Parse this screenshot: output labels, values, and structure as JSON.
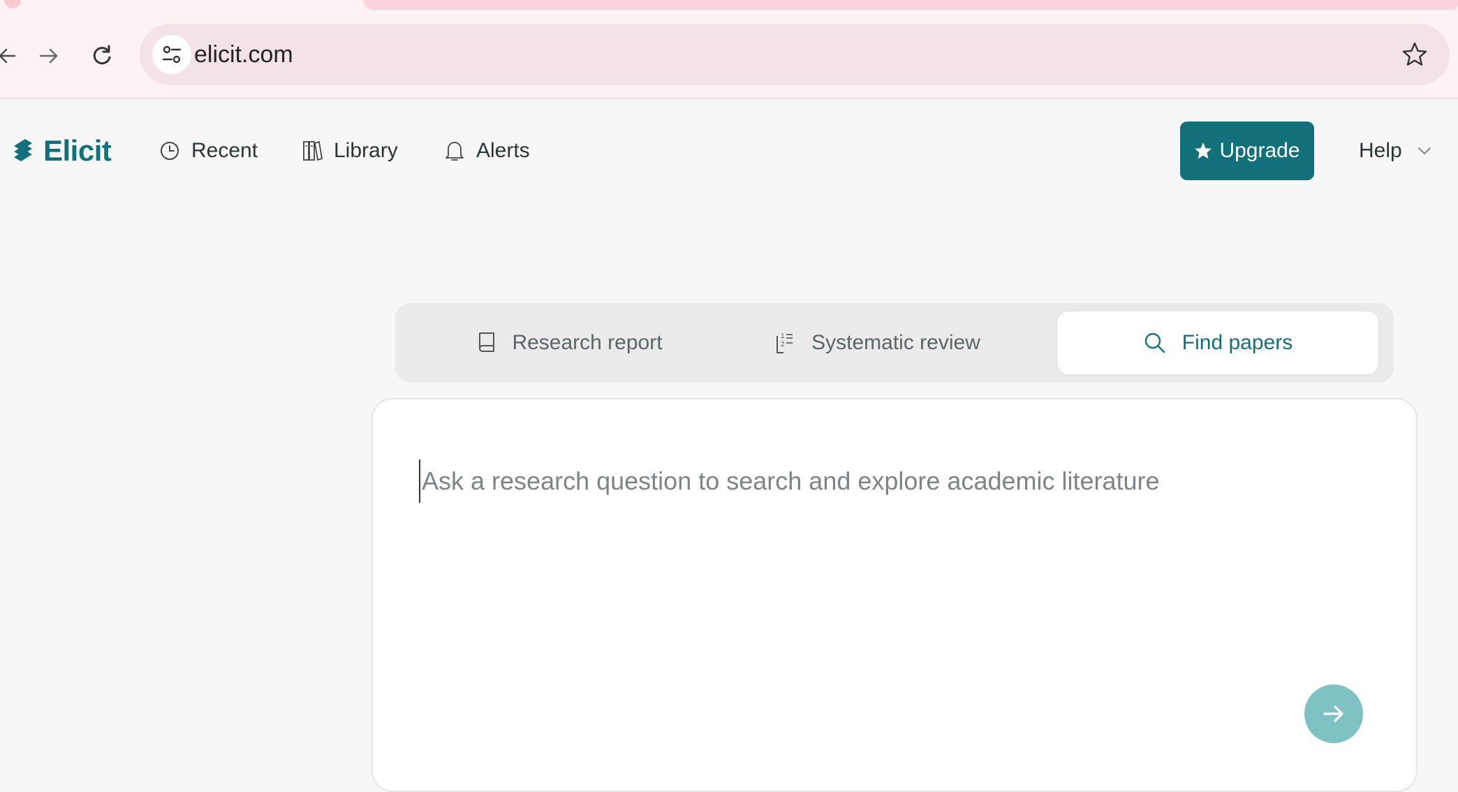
{
  "browser": {
    "url": "elicit.com",
    "icons": {
      "back": "arrow-left-icon",
      "forward": "arrow-right-icon",
      "reload": "reload-icon",
      "site_info": "tune-icon",
      "bookmark": "star-outline-icon"
    }
  },
  "header": {
    "logo_text": "Elicit",
    "nav": [
      {
        "label": "Recent",
        "icon": "clock-icon"
      },
      {
        "label": "Library",
        "icon": "books-icon"
      },
      {
        "label": "Alerts",
        "icon": "bell-icon"
      }
    ],
    "upgrade_label": "Upgrade",
    "help_label": "Help"
  },
  "modes": {
    "tabs": [
      {
        "label": "Research report",
        "icon": "book-icon",
        "active": false
      },
      {
        "label": "Systematic review",
        "icon": "numbered-list-icon",
        "active": false
      },
      {
        "label": "Find papers",
        "icon": "search-icon",
        "active": true
      }
    ]
  },
  "query": {
    "placeholder": "Ask a research question to search and explore academic literature",
    "value": ""
  },
  "colors": {
    "brand": "#12707a",
    "submit_disabled": "#7fc2c4",
    "chrome_bg": "#fdf3f4",
    "omnibox_bg": "#f3e3e7",
    "page_bg": "#f7f7f7"
  }
}
